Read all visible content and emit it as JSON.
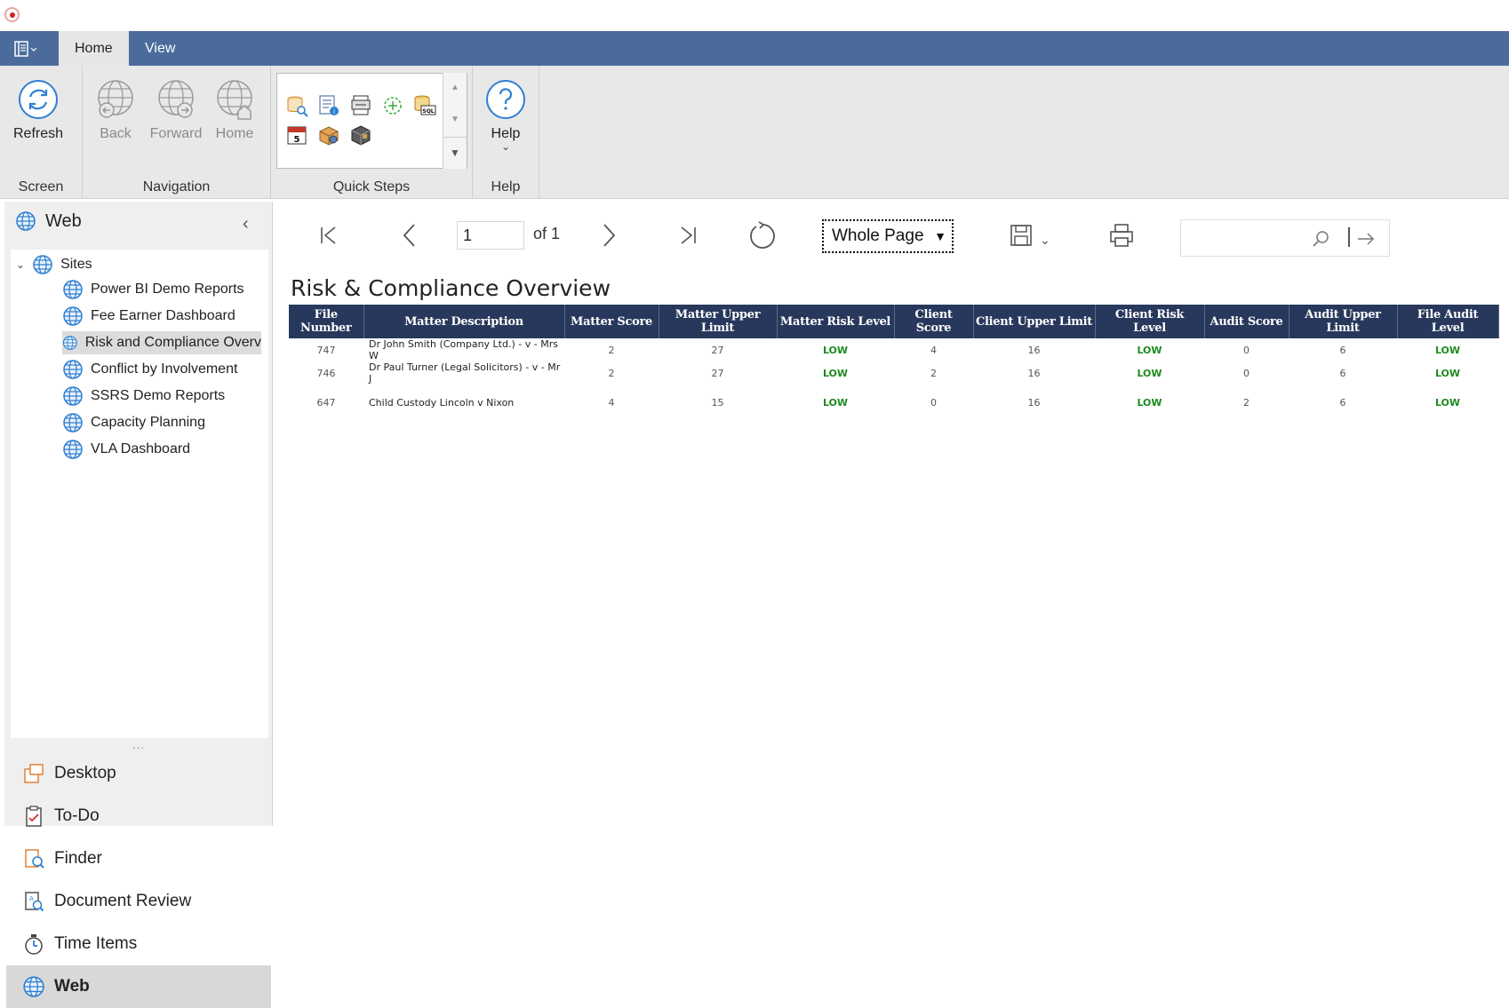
{
  "tabs": [
    {
      "label": "Home",
      "active": true
    },
    {
      "label": "View",
      "active": false
    }
  ],
  "ribbon": {
    "groups": {
      "screen": "Screen",
      "navigation": "Navigation",
      "quick_steps": "Quick Steps",
      "help": "Help"
    },
    "buttons": {
      "refresh": "Refresh",
      "back": "Back",
      "forward": "Forward",
      "home": "Home",
      "help": "Help"
    }
  },
  "left_pane": {
    "header": "Web",
    "tree_root": "Sites",
    "sites": [
      "Power BI Demo Reports",
      "Fee Earner Dashboard",
      "Risk and Compliance Overv",
      "Conflict by Involvement",
      "SSRS Demo Reports",
      "Capacity Planning",
      "VLA Dashboard"
    ],
    "selected_site_index": 2,
    "splitter": "...",
    "nav": [
      {
        "label": "Desktop",
        "icon": "desktop-icon"
      },
      {
        "label": "To-Do",
        "icon": "clipboard-check-icon"
      },
      {
        "label": "Finder",
        "icon": "finder-icon"
      },
      {
        "label": "Document Review",
        "icon": "document-review-icon"
      },
      {
        "label": "Time Items",
        "icon": "stopwatch-icon"
      },
      {
        "label": "Web",
        "icon": "globe-icon",
        "active": true
      }
    ]
  },
  "viewer": {
    "page_number": "1",
    "page_of": "of 1",
    "zoom": "Whole Page",
    "search_placeholder": ""
  },
  "report": {
    "title": "Risk & Compliance Overview",
    "columns": [
      "File Number",
      "Matter Description",
      "Matter Score",
      "Matter Upper Limit",
      "Matter Risk Level",
      "Client Score",
      "Client Upper Limit",
      "Client Risk Level",
      "Audit Score",
      "Audit Upper Limit",
      "File Audit Level"
    ],
    "rows": [
      [
        "747",
        "Dr John Smith (Company Ltd.) - v - Mrs W",
        "2",
        "27",
        "LOW",
        "4",
        "16",
        "LOW",
        "0",
        "6",
        "LOW"
      ],
      [
        "746",
        "Dr Paul Turner (Legal Solicitors) - v - Mr J",
        "2",
        "27",
        "LOW",
        "2",
        "16",
        "LOW",
        "0",
        "6",
        "LOW"
      ],
      [
        "647",
        "Child Custody Lincoln v Nixon",
        "4",
        "15",
        "LOW",
        "0",
        "16",
        "LOW",
        "2",
        "6",
        "LOW"
      ]
    ]
  },
  "colors": {
    "tabbar": "#4a6b9c",
    "table_header": "#28385c",
    "risk_low": "#1e8a1e",
    "ribbon": "#e8e8e8"
  }
}
